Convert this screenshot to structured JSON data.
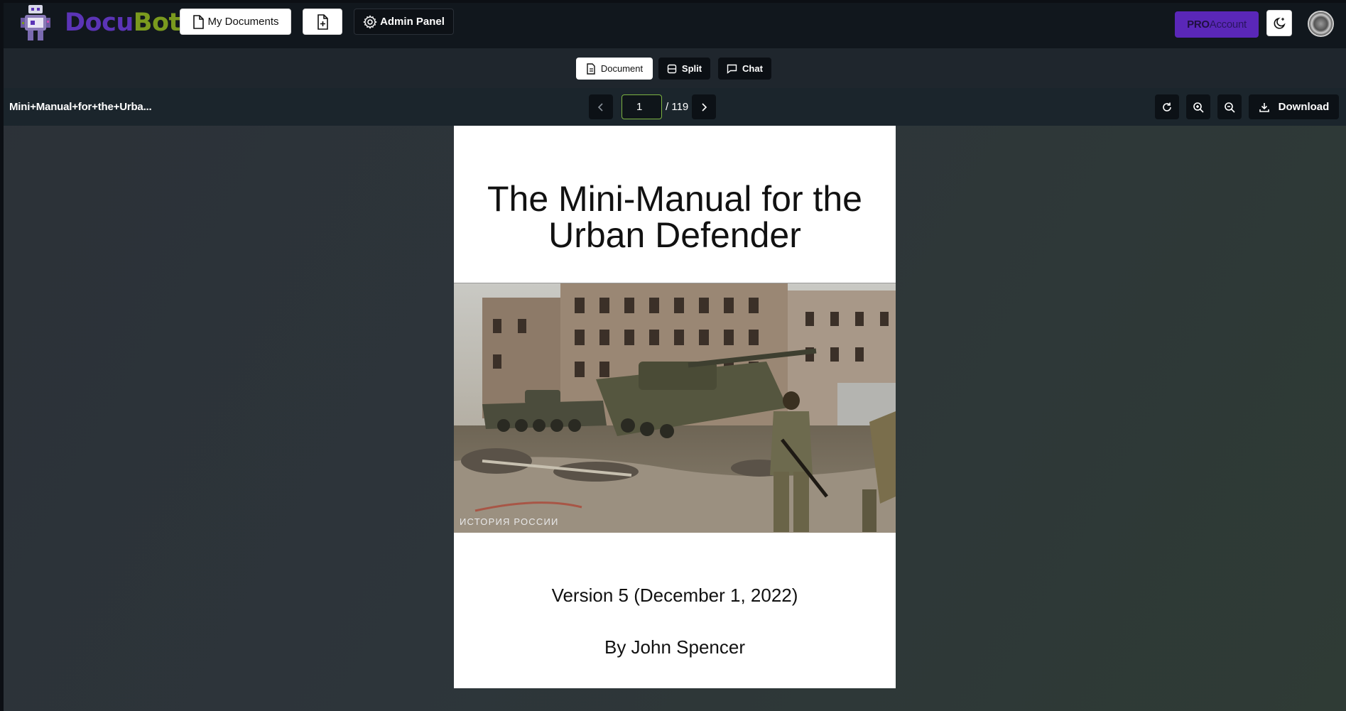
{
  "app": {
    "brand_part1": "Docu",
    "brand_part2": "Bot",
    "nav": {
      "my_documents": "My Documents",
      "admin_panel": "Admin Panel",
      "pro_label": "PRO",
      "account_label": "Account"
    }
  },
  "view_modes": {
    "document": "Document",
    "split": "Split",
    "chat": "Chat",
    "active": "Document"
  },
  "viewer": {
    "file_name": "Mini+Manual+for+the+Urba...",
    "current_page": "1",
    "total_pages": "/ 119",
    "download_label": "Download"
  },
  "document": {
    "title_line1": "The Mini-Manual for the",
    "title_line2": "Urban Defender",
    "photo_caption": "ИСТОРИЯ РОССИИ",
    "version": "Version 5 (December 1, 2022)",
    "author": "By John Spencer"
  },
  "colors": {
    "brand_purple": "#5b34b6",
    "brand_green": "#7a9a1e",
    "pro_button": "#5a27b8",
    "page_input_border": "#7cb342"
  },
  "icons": {
    "my_documents": "file-icon",
    "upload": "file-plus-icon",
    "admin": "gear-icon",
    "theme": "moon-stars-icon",
    "document_view": "document-icon",
    "split_view": "split-icon",
    "chat_view": "chat-bubble-icon",
    "prev": "chevron-left-icon",
    "next": "chevron-right-icon",
    "reload": "refresh-icon",
    "zoom_in": "zoom-in-icon",
    "zoom_out": "zoom-out-icon",
    "download": "download-icon"
  }
}
